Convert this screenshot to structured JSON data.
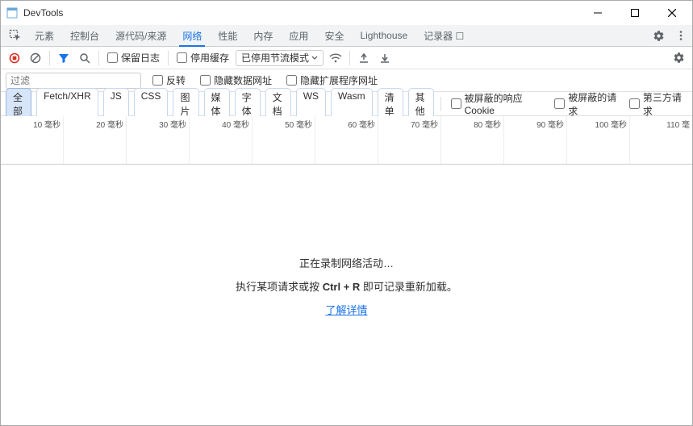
{
  "window": {
    "title": "DevTools"
  },
  "tabs": {
    "inspect_icon": "inspect-icon",
    "items": [
      "元素",
      "控制台",
      "源代码/来源",
      "网络",
      "性能",
      "内存",
      "应用",
      "安全",
      "Lighthouse",
      "记录器 ☐"
    ],
    "active_index": 3
  },
  "toolbar": {
    "preserve_log": "保留日志",
    "disable_cache": "停用缓存",
    "throttle": "已停用节流模式"
  },
  "filterbar": {
    "filter_placeholder": "过滤",
    "invert": "反转",
    "hide_data_urls": "隐藏数据网址",
    "hide_extension_urls": "隐藏扩展程序网址"
  },
  "typebar": {
    "pills": [
      "全部",
      "Fetch/XHR",
      "JS",
      "CSS",
      "图片",
      "媒体",
      "字体",
      "文档",
      "WS",
      "Wasm",
      "清单",
      "其他"
    ],
    "active_index": 0,
    "blocked_response_cookies": "被屏蔽的响应 Cookie",
    "blocked_requests": "被屏蔽的请求",
    "third_party": "第三方请求"
  },
  "timeline": {
    "ticks": [
      "10 毫秒",
      "20 毫秒",
      "30 毫秒",
      "40 毫秒",
      "50 毫秒",
      "60 毫秒",
      "70 毫秒",
      "80 毫秒",
      "90 毫秒",
      "100 毫秒",
      "110 毫"
    ]
  },
  "empty": {
    "line1": "正在录制网络活动…",
    "line2_pre": "执行某项请求或按 ",
    "line2_kbd": "Ctrl + R",
    "line2_post": " 即可记录重新加载。",
    "link": "了解详情"
  }
}
